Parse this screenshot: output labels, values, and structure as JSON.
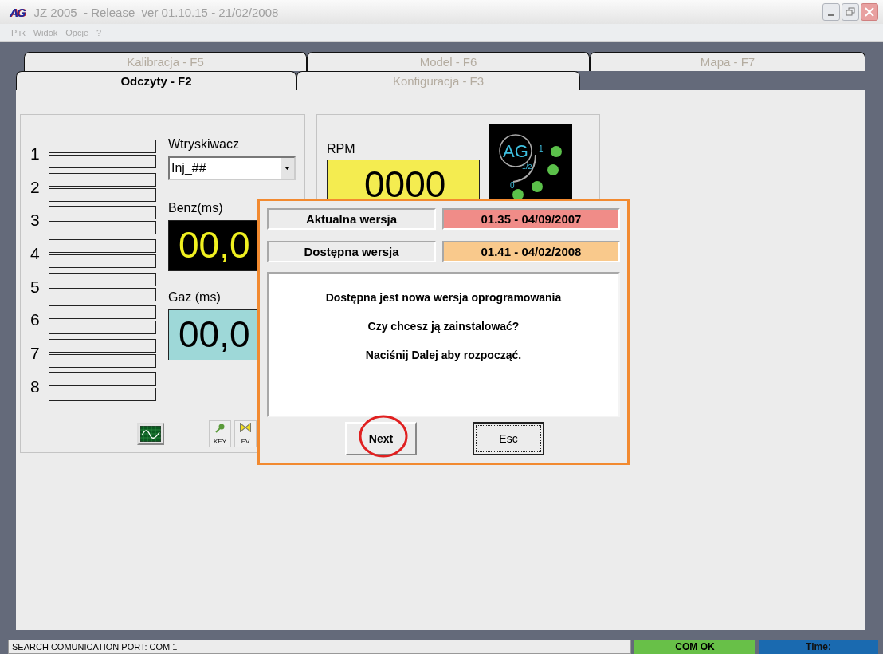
{
  "window": {
    "logo": "AG",
    "title": "JZ 2005  - Release  ver 01.10.15 - 21/02/2008"
  },
  "menu": [
    "Plik",
    "Widok",
    "Opcje",
    "?"
  ],
  "tabs_back": [
    {
      "label": "Kalibracja - F5",
      "selected": false
    },
    {
      "label": "Model - F6",
      "selected": false
    },
    {
      "label": "Mapa - F7",
      "selected": false
    }
  ],
  "tabs_front": [
    {
      "label": "Odczyty - F2",
      "selected": true
    },
    {
      "label": "Konfiguracja - F3",
      "selected": false
    }
  ],
  "cylinders": [
    "1",
    "2",
    "3",
    "4",
    "5",
    "6",
    "7",
    "8"
  ],
  "injector": {
    "label": "Wtryskiwacz",
    "value": "Inj_##"
  },
  "benz": {
    "label": "Benz(ms)",
    "reading": "00,0"
  },
  "gaz": {
    "label": "Gaz (ms)",
    "reading": "00,0"
  },
  "tool_buttons": [
    "KEY",
    "EV"
  ],
  "rpm": {
    "label": "RPM",
    "reading": "0000"
  },
  "gauge_logo": {
    "logo": "AG",
    "marks": [
      "1",
      "1/2",
      "0"
    ]
  },
  "dialog": {
    "versions": [
      {
        "label": "Aktualna wersja",
        "value": "01.35 - 04/09/2007",
        "color": "#f08c88"
      },
      {
        "label": "Dostępna wersja",
        "value": "01.41 - 04/02/2008",
        "color": "#f9c98c"
      }
    ],
    "message": [
      "Dostępna jest nowa wersja oprogramowania",
      "Czy chcesz ją zainstalować?",
      "Naciśnij Dalej aby rozpocząć."
    ],
    "buttons": [
      {
        "label": "Next",
        "focused": false
      },
      {
        "label": "Esc",
        "focused": true
      }
    ]
  },
  "status_bar": {
    "message": "SEARCH COMUNICATION PORT: COM 1",
    "connection": "COM OK",
    "time_label": "Time:"
  }
}
